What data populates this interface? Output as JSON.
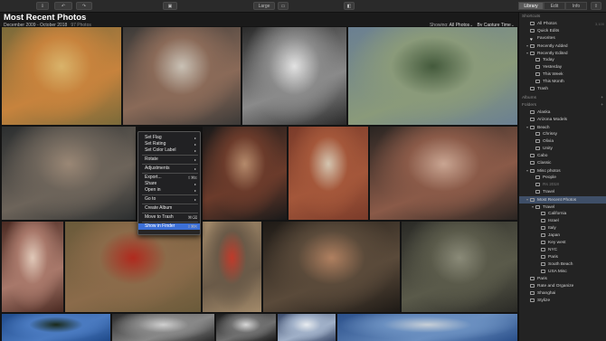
{
  "toolbar": {
    "view_size": "Large",
    "tabs": [
      "Library",
      "Edit",
      "Info"
    ],
    "active_tab": "Library"
  },
  "header": {
    "title": "Most Recent Photos",
    "date_range": "December 2009 - October 2018",
    "photo_count": "97 Photos",
    "showing_label": "Showing:",
    "showing_value": "All Photos",
    "sort_value": "By Capture Time"
  },
  "context_menu": [
    {
      "label": "Set Flag",
      "arrow": true
    },
    {
      "label": "Set Rating",
      "arrow": true
    },
    {
      "label": "Set Color Label",
      "arrow": true
    },
    {
      "sep": true
    },
    {
      "label": "Rotate",
      "arrow": true
    },
    {
      "sep": true
    },
    {
      "label": "Adjustments",
      "arrow": true
    },
    {
      "sep": true
    },
    {
      "label": "Export...",
      "shortcut": "⇧⌘E"
    },
    {
      "label": "Share",
      "arrow": true
    },
    {
      "label": "Open in",
      "arrow": true
    },
    {
      "sep": true
    },
    {
      "label": "Go to",
      "arrow": true
    },
    {
      "sep": true
    },
    {
      "label": "Create Album"
    },
    {
      "sep": true
    },
    {
      "label": "Move to Trash",
      "shortcut": "⌘⌫"
    },
    {
      "sep": true
    },
    {
      "label": "Show in Finder",
      "shortcut": "⇧⌘R",
      "highlighted": true
    }
  ],
  "sidebar": {
    "shortcuts_label": "Shortcuts",
    "shortcuts": [
      {
        "label": "All Photos",
        "indent": 1,
        "count": "3,100"
      },
      {
        "label": "Quick Edits",
        "indent": 1
      },
      {
        "label": "Favorites",
        "indent": 1,
        "icon": "heart"
      },
      {
        "label": "Recently Added",
        "indent": 1,
        "arrow": true
      },
      {
        "label": "Recently Edited",
        "indent": 1,
        "arrow": true
      },
      {
        "label": "Today",
        "indent": 2
      },
      {
        "label": "Yesterday",
        "indent": 2
      },
      {
        "label": "This Week",
        "indent": 2
      },
      {
        "label": "This Month",
        "indent": 2
      },
      {
        "label": "Trash",
        "indent": 1
      }
    ],
    "albums_label": "Albums",
    "folders_label": "Folders",
    "folders": [
      {
        "label": "Alaska",
        "indent": 1
      },
      {
        "label": "Arizona Models",
        "indent": 1
      },
      {
        "label": "Beach",
        "indent": 1,
        "arrow": true
      },
      {
        "label": "Chrissy",
        "indent": 2
      },
      {
        "label": "Olivia",
        "indent": 2
      },
      {
        "label": "Unity",
        "indent": 2
      },
      {
        "label": "Cabo",
        "indent": 1
      },
      {
        "label": "Classic",
        "indent": 1
      },
      {
        "label": "Misc photos",
        "indent": 1,
        "arrow": true
      },
      {
        "label": "People",
        "indent": 2
      },
      {
        "label": "Rs 2018",
        "indent": 2,
        "dim": true
      },
      {
        "label": "Travel",
        "indent": 2
      },
      {
        "label": "Most Recent Photos",
        "indent": 1,
        "arrow": true,
        "highlighted": true
      },
      {
        "label": "Travel",
        "indent": 2,
        "arrow": true
      },
      {
        "label": "California",
        "indent": 3
      },
      {
        "label": "Israel",
        "indent": 3
      },
      {
        "label": "Italy",
        "indent": 3
      },
      {
        "label": "Japan",
        "indent": 3
      },
      {
        "label": "Key west",
        "indent": 3
      },
      {
        "label": "NYC",
        "indent": 3
      },
      {
        "label": "Paris",
        "indent": 3
      },
      {
        "label": "South Beach",
        "indent": 3
      },
      {
        "label": "USA Misc",
        "indent": 3
      },
      {
        "label": "Paris",
        "indent": 1
      },
      {
        "label": "Rate and Organize",
        "indent": 1
      },
      {
        "label": "Shanghai",
        "indent": 1
      },
      {
        "label": "Stylize",
        "indent": 1
      }
    ]
  },
  "photos": [
    {
      "name": "striped-dress-woman",
      "colors": [
        "#7a6a3a",
        "#c7833d",
        "#d9b36a"
      ]
    },
    {
      "name": "woman-window-portrait",
      "colors": [
        "#3c3a38",
        "#8a6a58",
        "#c9c1b5"
      ]
    },
    {
      "name": "bw-woman-portrait",
      "colors": [
        "#2a2a2a",
        "#8a8a8a",
        "#e2e2e2"
      ]
    },
    {
      "name": "mountain-lake",
      "colors": [
        "#6a7f92",
        "#8a9a7a",
        "#445a3c"
      ]
    },
    {
      "name": "woman-with-dog",
      "colors": [
        "#2b2e2f",
        "#6d645a",
        "#9a8775"
      ]
    },
    {
      "name": "red-hair-woman",
      "colors": [
        "#1a1a1a",
        "#6b3b2b",
        "#b58a6b"
      ]
    },
    {
      "name": "white-dress-brick",
      "colors": [
        "#7a3b2a",
        "#a4573a",
        "#d4c5b0"
      ]
    },
    {
      "name": "cowboy-hat-woman",
      "colors": [
        "#2a2522",
        "#8a5a48",
        "#c9a592"
      ]
    },
    {
      "name": "lingerie-window",
      "colors": [
        "#4a2a22",
        "#a8786a",
        "#e0c8b8"
      ]
    },
    {
      "name": "red-dress-wagon",
      "colors": [
        "#6a5a3a",
        "#8b6b4a",
        "#b02a1e"
      ]
    },
    {
      "name": "red-dress-fence",
      "colors": [
        "#a38a6a",
        "#6a5a48",
        "#c03a2a"
      ]
    },
    {
      "name": "black-hat-woman",
      "colors": [
        "#1e1a16",
        "#5a4a3a",
        "#b08060"
      ]
    },
    {
      "name": "bearded-soldier",
      "colors": [
        "#2a2a26",
        "#5a5a4a",
        "#8a8a78"
      ]
    },
    {
      "name": "blue-sky-tree",
      "colors": [
        "#1f4a8a",
        "#4a7ac0",
        "#1a2a1a"
      ]
    },
    {
      "name": "bw-clouds",
      "colors": [
        "#2a2a2a",
        "#888888",
        "#d0d0d0"
      ]
    },
    {
      "name": "dancer-silhouette",
      "colors": [
        "#1a1a1a",
        "#707070",
        "#d8d8d8"
      ]
    },
    {
      "name": "woman-blue-top",
      "colors": [
        "#3a4a6a",
        "#a0b0c8",
        "#e8ecf0"
      ]
    },
    {
      "name": "cityscape-sky",
      "colors": [
        "#2a4f8a",
        "#6a8fc0",
        "#c8d0d8"
      ]
    }
  ]
}
